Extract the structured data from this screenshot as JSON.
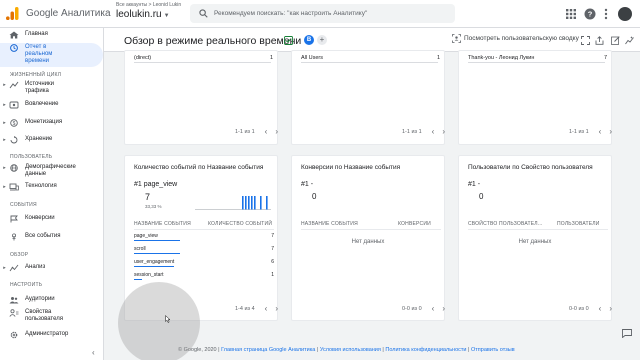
{
  "app": {
    "product": "Google Аналитика",
    "breadcrumb": "Все аккаунты > Leonid Lukin",
    "property": "leolukin.ru",
    "search_placeholder": "Рекомендуем поискать: \"как настроить Аналитику\""
  },
  "sidebar": {
    "items": [
      {
        "label": "Главная"
      },
      {
        "label": "Отчет в реальном времени",
        "active": true
      },
      {
        "label": "Источники трафика"
      },
      {
        "label": "Вовлечение"
      },
      {
        "label": "Монетизация"
      },
      {
        "label": "Хранение"
      },
      {
        "label": "Демографические данные"
      },
      {
        "label": "Технология"
      },
      {
        "label": "Конверсии"
      },
      {
        "label": "Все события"
      },
      {
        "label": "Анализ"
      },
      {
        "label": "Аудитории"
      },
      {
        "label": "Свойства пользователя"
      },
      {
        "label": "Администратор"
      }
    ],
    "sections": {
      "lifecycle": "ЖИЗНЕННЫЙ ЦИКЛ",
      "user": "ПОЛЬЗОВАТЕЛЬ",
      "events": "СОБЫТИЯ",
      "explore": "ОБЗОР",
      "configure": "НАСТРОИТЬ"
    }
  },
  "header": {
    "title": "Обзор в режиме реального времени",
    "chip_label": "B",
    "user_journey": "Посмотреть пользовательскую сводку"
  },
  "top_cards": [
    {
      "row_label": "(direct)",
      "row_value": "1",
      "pager": "1-1 из 1"
    },
    {
      "row_label": "All Users",
      "row_value": "1",
      "pager": "1-1 из 1"
    },
    {
      "row_label": "Thank-you - Леонид Лукин",
      "row_value": "7",
      "pager": "1-1 из 1"
    }
  ],
  "events_card": {
    "title": "Количество событий по Название события",
    "top_rank": "#1 page_view",
    "top_value": "7",
    "top_pct": "33,33 %",
    "col_name": "НАЗВАНИЕ СОБЫТИЯ",
    "col_value": "КОЛИЧЕСТВО СОБЫТИЙ",
    "rows": [
      {
        "name": "page_view",
        "value": 7
      },
      {
        "name": "scroll",
        "value": 7
      },
      {
        "name": "user_engagement",
        "value": 6
      },
      {
        "name": "session_start",
        "value": 1
      }
    ],
    "pager": "1-4 из 4"
  },
  "conversions_card": {
    "title": "Конверсии по Название события",
    "top_rank": "#1 -",
    "top_value": "0",
    "col_name": "НАЗВАНИЕ СОБЫТИЯ",
    "col_value": "КОНВЕРСИИ",
    "empty": "Нет данных",
    "pager": "0-0 из 0"
  },
  "users_card": {
    "title": "Пользователи по Свойство пользователя",
    "top_rank": "#1 -",
    "top_value": "0",
    "col_name": "СВОЙСТВО ПОЛЬЗОВАТЕЛ...",
    "col_value": "ПОЛЬЗОВАТЕЛИ",
    "empty": "Нет данных",
    "pager": "0-0 из 0"
  },
  "footer": {
    "copyright": "© ",
    "year": "Google, 2020",
    "links": [
      "Главная страница Google Аналитика",
      "Условия использования",
      "Политика конфиденциальности",
      "Отправить отзыв"
    ],
    "sep": " | "
  },
  "colors": {
    "accent": "#1a73e8",
    "logo_orange": "#f9ab00",
    "logo_dark": "#e37400",
    "active_bg": "#e8f0fe"
  }
}
